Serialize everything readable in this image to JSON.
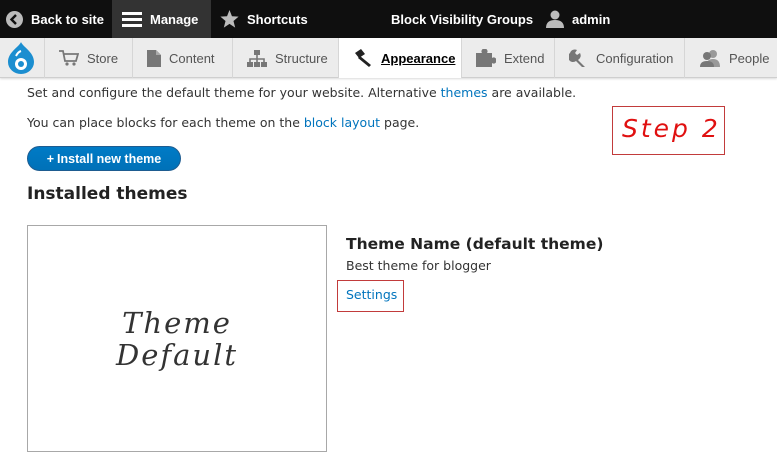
{
  "toolbar": {
    "back_label": "Back to site",
    "manage_label": "Manage",
    "shortcuts_label": "Shortcuts",
    "center_label": "Block Visibility Groups",
    "user_label": "admin"
  },
  "tray": {
    "items": [
      {
        "label": "Store",
        "icon": "cart-icon"
      },
      {
        "label": "Content",
        "icon": "document-icon"
      },
      {
        "label": "Structure",
        "icon": "structure-icon"
      },
      {
        "label": "Appearance",
        "icon": "paintbrush-icon"
      },
      {
        "label": "Extend",
        "icon": "puzzle-icon"
      },
      {
        "label": "Configuration",
        "icon": "wrench-icon"
      },
      {
        "label": "People",
        "icon": "people-icon"
      }
    ]
  },
  "intro": {
    "line1_before": "Set and configure the default theme for your website. Alternative ",
    "line1_link": "themes",
    "line1_after": " are available.",
    "line2_before": "You can place blocks for each theme on the ",
    "line2_link": "block layout",
    "line2_after": " page."
  },
  "install_button": {
    "plus": "+",
    "label": "Install new theme"
  },
  "installed_title": "Installed themes",
  "theme": {
    "screenshot_line1": "Theme",
    "screenshot_line2": "Default",
    "name": "Theme Name (default theme)",
    "description": "Best theme for blogger",
    "settings_link": "Settings"
  },
  "annotation": {
    "step_label": "Step 2",
    "color": "#e01010"
  },
  "colors": {
    "accent": "#0074bd",
    "toolbar": "#0f0f0f",
    "annotation_border": "#c23b3b"
  }
}
